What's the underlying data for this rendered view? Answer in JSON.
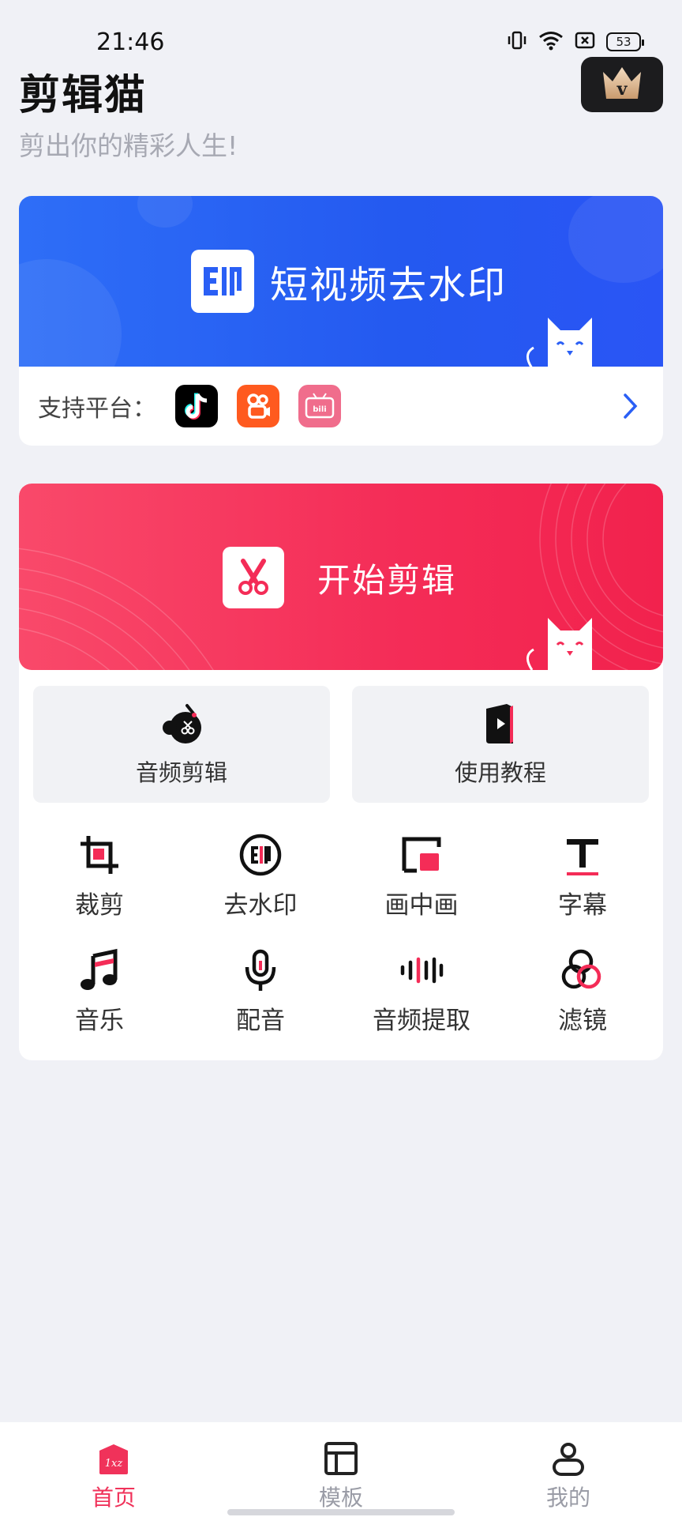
{
  "status_bar": {
    "time": "21:46",
    "battery": "53"
  },
  "header": {
    "title": "剪辑猫",
    "subtitle": "剪出你的精彩人生!",
    "vip_icon_letter": "v"
  },
  "watermark_card": {
    "banner_title": "短视频去水印",
    "logo_text": "E\u0010",
    "support_label": "支持平台：",
    "platforms": [
      {
        "name": "douyin",
        "color": "#000000"
      },
      {
        "name": "kuaishou",
        "color": "#ff5a1f"
      },
      {
        "name": "bilibili",
        "color": "#f06d8c"
      }
    ]
  },
  "edit_card": {
    "banner_title": "开始剪辑",
    "tiles": [
      {
        "label": "音频剪辑",
        "icon": "audio-cut-icon"
      },
      {
        "label": "使用教程",
        "icon": "tutorial-book-icon"
      }
    ],
    "tools": [
      {
        "label": "裁剪",
        "icon": "crop-icon"
      },
      {
        "label": "去水印",
        "icon": "watermark-remove-icon"
      },
      {
        "label": "画中画",
        "icon": "picture-in-picture-icon"
      },
      {
        "label": "字幕",
        "icon": "subtitle-icon"
      },
      {
        "label": "音乐",
        "icon": "music-note-icon"
      },
      {
        "label": "配音",
        "icon": "microphone-icon"
      },
      {
        "label": "音频提取",
        "icon": "audio-wave-icon"
      },
      {
        "label": "滤镜",
        "icon": "filter-icon"
      }
    ]
  },
  "bottom_nav": {
    "items": [
      {
        "label": "首页",
        "icon": "home-icon",
        "active": true
      },
      {
        "label": "模板",
        "icon": "template-icon",
        "active": false
      },
      {
        "label": "我的",
        "icon": "profile-icon",
        "active": false
      }
    ]
  },
  "colors": {
    "accent_red": "#f0325a",
    "banner_blue": "#2a5ff5",
    "banner_red": "#f42c57",
    "background": "#f0f1f6"
  }
}
